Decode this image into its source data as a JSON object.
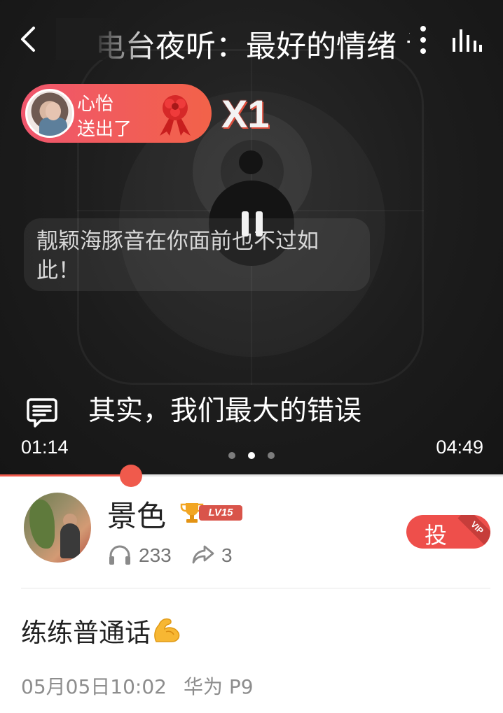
{
  "player": {
    "title": "电台夜听：最好的情绪 请",
    "gift": {
      "sender": "心怡",
      "action": "送出了",
      "count": "X1"
    },
    "danmu_comment": "靓颖海豚音在你面前也不过如此！",
    "lyric": "其实，我们最大的错误",
    "time_current": "01:14",
    "time_total": "04:49",
    "progress_fraction": 0.26,
    "page_dots": 3,
    "active_page": 1
  },
  "user": {
    "name": "景色",
    "level": "LV15",
    "listen_count": "233",
    "share_count": "3",
    "vote_label": "投",
    "vip_label": "VIP"
  },
  "post": {
    "text": "练练普通话",
    "date": "05月05日10:02",
    "device": "华为 P9"
  },
  "colors": {
    "accent": "#f05a4c",
    "gift_pill_start": "#f0566d",
    "gift_pill_end": "#f26249",
    "player_bg": "#1c1c1c"
  },
  "icons": [
    "back-icon",
    "more-icon",
    "bars-icon",
    "gift-bow-icon",
    "pause-icon",
    "danmu-icon",
    "trophy-icon",
    "headphone-icon",
    "share-icon",
    "muscle-icon"
  ]
}
